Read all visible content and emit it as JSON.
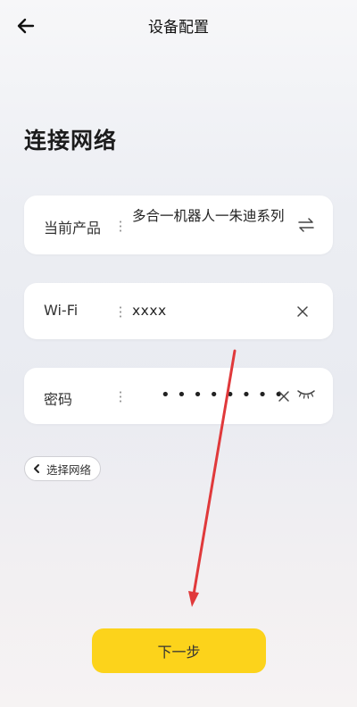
{
  "header": {
    "title": "设备配置",
    "back_icon": "back-arrow-icon"
  },
  "heading": "连接网络",
  "form": {
    "product": {
      "label": "当前产品",
      "value": "多合一机器人一朱迪系列",
      "icon": "swap-icon"
    },
    "wifi": {
      "label": "Wi-Fi",
      "value": "xxxx",
      "icon": "clear-icon"
    },
    "password": {
      "label": "密码",
      "value": "••••••••",
      "icons": [
        "clear-icon",
        "eye-closed-icon"
      ]
    }
  },
  "select_network": {
    "label": "选择网络",
    "icon": "chevron-left-icon"
  },
  "next_button": {
    "label": "下一步"
  },
  "colors": {
    "accent": "#fcd31b",
    "annotation": "#e0393b"
  }
}
